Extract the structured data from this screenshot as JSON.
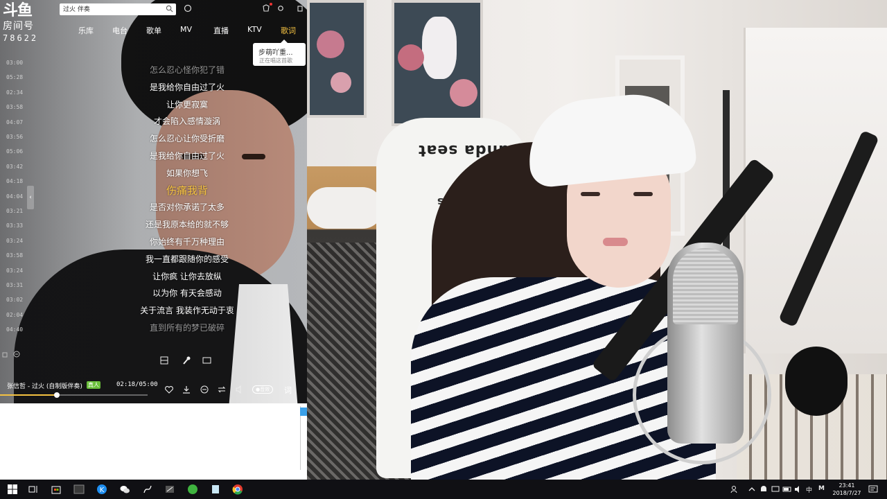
{
  "logo": {
    "mark": "斗鱼",
    "label": "房间号",
    "room_number": "78622"
  },
  "search": {
    "value": "过火 伴奏"
  },
  "nav": [
    "乐库",
    "电台",
    "歌单",
    "MV",
    "直播",
    "KTV",
    "歌词"
  ],
  "nav_active": "歌词",
  "tooltip": {
    "title": "步萌吖重...",
    "subtitle": "正在唱这首歌"
  },
  "timeline": [
    "03:00",
    "05:28",
    "02:34",
    "03:58",
    "04:07",
    "03:56",
    "05:06",
    "03:42",
    "04:18",
    "04:04",
    "03:21",
    "03:33",
    "03:24",
    "03:58",
    "03:24",
    "03:31",
    "03:02",
    "02:04",
    "04:40"
  ],
  "lyrics": [
    "怎么忍心怪你犯了错",
    "是我给你自由过了火",
    "让你更寂寞",
    "才会陷入感情漩涡",
    "怎么忍心让你受折磨",
    "是我给你自由过了火",
    "如果你想飞",
    "伤痛我背",
    "是否对你承诺了太多",
    "还是我原本给的就不够",
    "你始终有千万种理由",
    "我一直都跟随你的感受",
    "让你疯 让你去放纵",
    "以为你 有天会感动",
    "关于流言 我装作无动于衷",
    "直到所有的梦已破碎"
  ],
  "lyrics_current_index": 7,
  "player": {
    "song": "张信哲 - 过火 (自制版伴奏)",
    "badge": "真人",
    "time": "02:18/05:00",
    "progress": 0.46,
    "quality": "●音效",
    "lyrics_toggle": "词"
  },
  "colors": {
    "accent": "#f5c242",
    "badge": "#6bbf3b",
    "taskbar": "#101014"
  },
  "webcam": {
    "chair_label": "anda seat",
    "chair_sub": "a bus"
  },
  "taskbar": {
    "apps": [
      "start-icon",
      "task-view-icon",
      "store-icon",
      "terminal-icon",
      "kugou-icon",
      "wechat-icon",
      "obs-icon",
      "capture-icon",
      "chat-app-icon",
      "notes-icon",
      "chrome-icon"
    ],
    "ime": "中",
    "ime_mode": "M",
    "time": "23:41",
    "date": "2018/7/27"
  }
}
